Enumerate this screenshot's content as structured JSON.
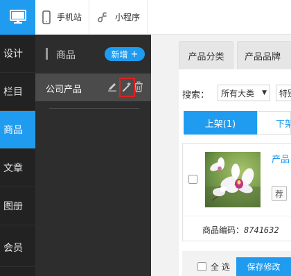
{
  "colors": {
    "accent": "#1f9cf0",
    "rail": "#222222",
    "panel": "#2d2d2d",
    "highlight": "#e02020"
  },
  "topbar": {
    "mobile_site": "手机站",
    "mini_program": "小程序"
  },
  "rail": {
    "logo_icon": "monitor-icon",
    "items": [
      {
        "label": "设计"
      },
      {
        "label": "栏目"
      },
      {
        "label": "商品"
      },
      {
        "label": "文章"
      },
      {
        "label": "图册"
      },
      {
        "label": "会员"
      }
    ]
  },
  "panel": {
    "title": "商品",
    "add_label": "新增",
    "categories": [
      {
        "label": "公司产品"
      }
    ]
  },
  "main": {
    "tabs": [
      {
        "label": "产品分类"
      },
      {
        "label": "产品品牌"
      }
    ],
    "search": {
      "label": "搜索：",
      "category_select": "所有大类",
      "second_select": "特别"
    },
    "filters": {
      "on_shelf": "上架(1)",
      "off_shelf": "下架"
    },
    "product": {
      "name": "产品",
      "recommend": "荐",
      "code_label": "商品编码：",
      "code_value": "8741632"
    },
    "footer": {
      "select_all": "全 选",
      "save": "保存修改"
    }
  }
}
